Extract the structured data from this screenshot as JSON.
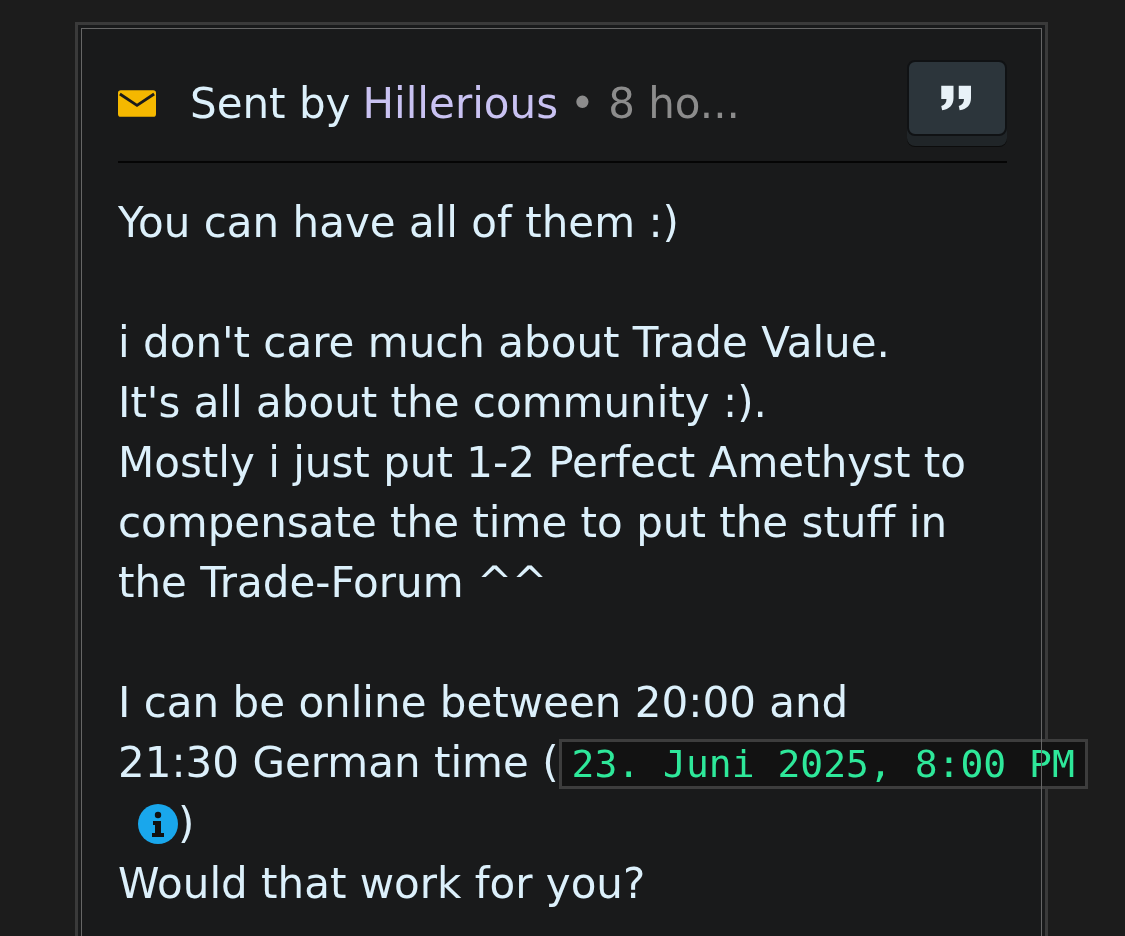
{
  "message": {
    "sender_prefix": "Sent by",
    "sender": "Hillerious",
    "time": "• 8 ho...",
    "paragraphs": [
      "You can have all of them :)",
      "i don't care much about Trade Value.\nIt's all about the community :).\nMostly i just put 1-2 Perfect Amethyst to compensate the time to put the stuff in the Trade-Forum ^^"
    ],
    "last": {
      "before": [
        "I can be online between 20:00 and",
        "21:30 German time ("
      ],
      "timestamp": "23. Juni 2025, 8:00 PM",
      "after": ")",
      "closing": "Would that work for you?"
    }
  }
}
